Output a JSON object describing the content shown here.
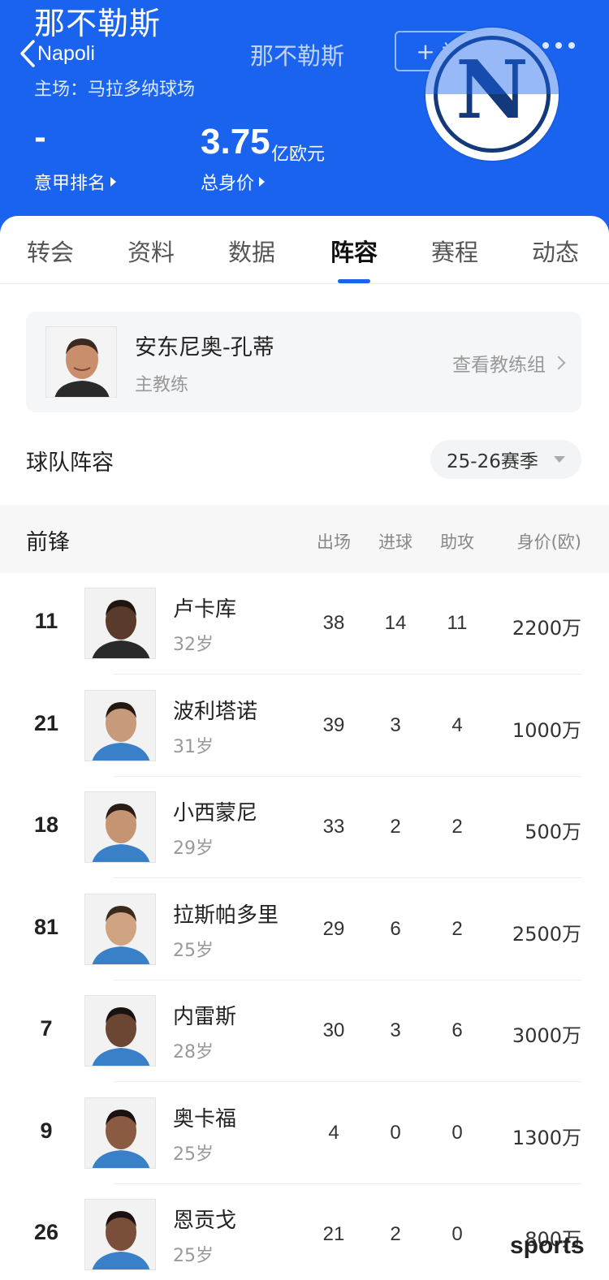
{
  "header": {
    "team_name_cn": "那不勒斯",
    "back_label": "Napoli",
    "title": "那不勒斯",
    "follow_label": "关注",
    "stadium": "主场：马拉多纳球场",
    "rank_value": "-",
    "rank_label": "意甲排名",
    "value_number": "3.75",
    "value_unit": "亿欧元",
    "value_label": "总身价",
    "logo_letter": "N",
    "brand_color": "#1a63ee",
    "logo_color": "#13397a"
  },
  "tabs": [
    {
      "label": "转会"
    },
    {
      "label": "资料"
    },
    {
      "label": "数据"
    },
    {
      "label": "阵容",
      "active": true
    },
    {
      "label": "赛程"
    },
    {
      "label": "动态"
    }
  ],
  "coach": {
    "name": "安东尼奥-孔蒂",
    "role": "主教练",
    "link_label": "查看教练组"
  },
  "squad": {
    "title": "球队阵容",
    "season": "25-26赛季",
    "position_group": "前锋",
    "columns": {
      "apps": "出场",
      "goals": "进球",
      "assists": "助攻",
      "value": "身价(欧)"
    },
    "players": [
      {
        "number": "11",
        "name": "卢卡库",
        "age": "32岁",
        "apps": "38",
        "goals": "14",
        "assists": "11",
        "value": "2200万"
      },
      {
        "number": "21",
        "name": "波利塔诺",
        "age": "31岁",
        "apps": "39",
        "goals": "3",
        "assists": "4",
        "value": "1000万"
      },
      {
        "number": "18",
        "name": "小西蒙尼",
        "age": "29岁",
        "apps": "33",
        "goals": "2",
        "assists": "2",
        "value": "500万"
      },
      {
        "number": "81",
        "name": "拉斯帕多里",
        "age": "25岁",
        "apps": "29",
        "goals": "6",
        "assists": "2",
        "value": "2500万"
      },
      {
        "number": "7",
        "name": "内雷斯",
        "age": "28岁",
        "apps": "30",
        "goals": "3",
        "assists": "6",
        "value": "3000万"
      },
      {
        "number": "9",
        "name": "奥卡福",
        "age": "25岁",
        "apps": "4",
        "goals": "0",
        "assists": "0",
        "value": "1300万"
      },
      {
        "number": "26",
        "name": "恩贡戈",
        "age": "25岁",
        "apps": "21",
        "goals": "2",
        "assists": "0",
        "value": "800万"
      }
    ]
  },
  "watermark": "sports"
}
